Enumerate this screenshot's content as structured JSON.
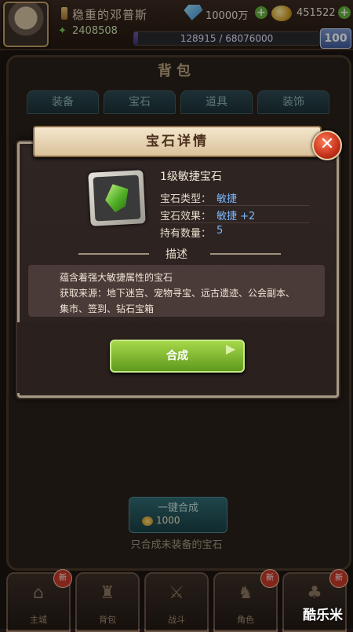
{
  "player": {
    "name": "稳重的邓普斯",
    "power": "2408508",
    "diamonds": "10000万",
    "gold": "451522",
    "exp_text": "128915 / 68076000",
    "exp_fraction": 0.0019,
    "level": "100"
  },
  "backpack": {
    "title": "背包",
    "tabs": [
      "装备",
      "宝石",
      "道具",
      "装饰"
    ]
  },
  "dialog": {
    "title": "宝石详情",
    "gem_name": "1级敏捷宝石",
    "type_label": "宝石类型：",
    "type_value": "敏捷",
    "effect_label": "宝石效果：",
    "effect_value": "敏捷 +2",
    "count_label": "持有数量：",
    "count_value": "5",
    "desc_title": "描述",
    "desc_lines": [
      "蕴含着强大敏捷属性的宝石",
      "获取来源：地下迷宫、宠物寻宝、远古遗迹、公会副本、",
      "集市、签到、钻石宝箱"
    ],
    "synth_label": "合成"
  },
  "oneclick": {
    "label": "一键合成",
    "cost": "1000",
    "hint": "只合成未装备的宝石"
  },
  "nav": [
    {
      "label": "主城",
      "badge": "新"
    },
    {
      "label": "背包",
      "badge": ""
    },
    {
      "label": "战斗",
      "badge": ""
    },
    {
      "label": "角色",
      "badge": "新"
    },
    {
      "label": "",
      "badge": "新"
    }
  ],
  "watermark": "酷乐米"
}
